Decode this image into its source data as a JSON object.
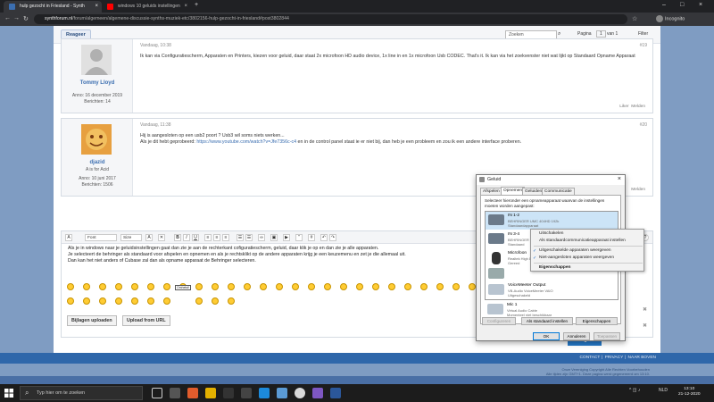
{
  "browser": {
    "tabs": [
      {
        "title": "hulp gezocht in Friesland - Synth"
      },
      {
        "title": "windows 10 geluids instellingen"
      }
    ],
    "url_domain": "synthforum.nl",
    "url_path": "/forum/algemeen/algemene-discussie-synths-muziek-etc/3802156-hulp-gezocht-in-friesland#post3802844",
    "profile": "Incognito"
  },
  "forum": {
    "reply_top": "Reageer",
    "search_placeholder": "Zoeken",
    "page_label": "Pagina",
    "page_num": "1",
    "page_of": "van 1",
    "filter": "Filter",
    "posts": [
      {
        "date": "Vandaag, 10:38",
        "num": "#19",
        "user": "Tommy Lloyd",
        "rank": "",
        "joined": "Anno: 16 december 2019",
        "count": "Berichten: 14",
        "text": "Ik kan via Configuratiescherm, Apparaten en Printers, kiezen voor geluid, daar staat 2x microfoon HD audio device, 1x line in en 1x microfoon Usb CODEC. That's it. Ik kan via het zoekvenster niet wat lijkt op Standaard Opname Apparaat",
        "like": "Liker",
        "report": "Melden"
      },
      {
        "date": "Vandaag, 11:38",
        "num": "#20",
        "user": "djazid",
        "rank": "A is for Acid",
        "joined": "Anno: 10 juni 2017",
        "count": "Berichten: 1506",
        "text_1": "Hij is aangesloten op een usb2 poort ? Usb3 wil soms niets werken...",
        "text_2_pre": "Als je dit hebt geprobeerd:",
        "link": "https://www.youtube.com/watch?v=Jfe7356c-c4",
        "text_2_post": "en in de control panel staat ie er niet bij, dan heb je een probleem en zou ik een andere interface proberen.",
        "report": "Melden"
      }
    ],
    "editor": {
      "font": "Font",
      "size": "Size",
      "text_1": "Als je in windows naar je geluidsinstellingen gaat dan zie je aan de rechterkant cofiguratiescherm, geluid, daar klik je op en dan zie je alle apparaten.",
      "text_2": "Je selecteert de behringer als standaard voor afspelen en opnemen en als je rechtsklikt op de andere apparaten krijg je een keuzemenu en zet je die allemaal uit.",
      "text_3": "Dan kan het niet anders of Cubase zal dan als opname apparaat de Behringer selecteren.",
      "attach_btn": "Bijlagen uploaden",
      "url_btn": "Upload from URL",
      "smiley_badge": "Omhelst!"
    },
    "reply_btn": "Reageer",
    "footer": [
      "CONTACT",
      "PRIVACY",
      "NAAR BOVEN"
    ],
    "footer_small_1": "Onze Vereniging Copyright Alle Rechten Voorbehouden",
    "footer_small_2": "Alle tijden zijn GMT+1. Deze pagina werd gegenereerd om 13:10."
  },
  "dialog": {
    "title": "Geluid",
    "tabs": [
      "Afspelen",
      "Opnemen",
      "Geluiden",
      "Communicatie"
    ],
    "instructions": "Selecteer hieronder een opnameapparaat waarvan de instellingen moeten worden aangepast:",
    "devices": [
      {
        "name": "IN 1-2",
        "sub": "BEHRINGER UMC 404HD 192k",
        "sub2": "Standaardapparaat"
      },
      {
        "name": "IN 3-4",
        "sub": "BEHRINGER UMC 404HD 192k",
        "sub2": "Standaard"
      },
      {
        "name": "Microfoon",
        "sub": "Realtek High Definition Audio",
        "sub2": "Gereed"
      },
      {
        "name": "",
        "sub": "",
        "sub2": ""
      },
      {
        "name": "VoiceMeeter Output",
        "sub": "VB-Audio VoiceMeeter VAIO",
        "sub2": "Uitgeschakeld"
      },
      {
        "name": "Mic 1",
        "sub": "Virtual Audio Cable",
        "sub2": "Momenteel niet beschikbaar"
      }
    ],
    "btn_configure": "Configureren",
    "btn_default": "Als standaard instellen",
    "btn_props": "Eigenschappen",
    "btn_ok": "OK",
    "btn_cancel": "Annuleren",
    "btn_apply": "Toepassen"
  },
  "context_menu": {
    "items": [
      {
        "label": "Uitschakelen",
        "checked": false
      },
      {
        "label": "Als standaardcommunicatieapparaat instellen",
        "checked": false
      },
      {
        "label": "Uitgeschakelde apparaten weergeven",
        "checked": true
      },
      {
        "label": "Niet-aangesloten apparaten weergeven",
        "checked": true
      },
      {
        "label": "Eigenschappen",
        "checked": false
      }
    ]
  },
  "taskbar": {
    "search": "Typ hier om te zoeken",
    "lang": "NLD",
    "time": "13:10",
    "date": "21-12-2020"
  }
}
